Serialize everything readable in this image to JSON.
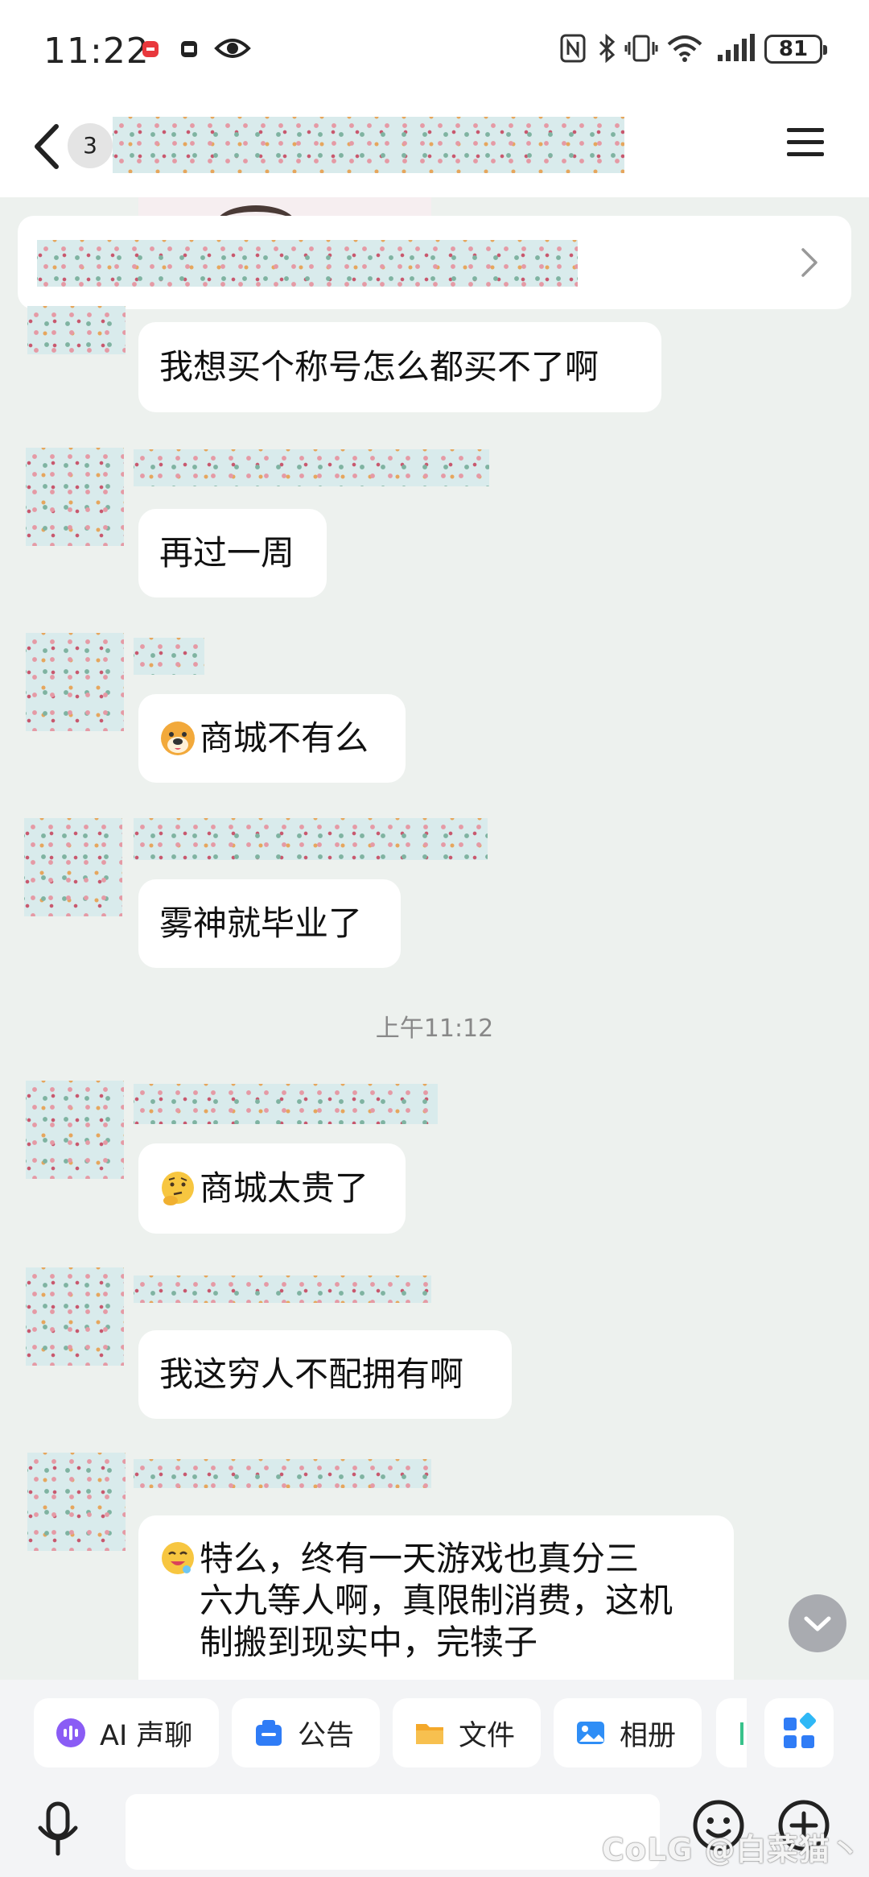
{
  "status_bar": {
    "time": "11:22",
    "battery": "81",
    "icons": [
      "app-notification-icon",
      "app-icon",
      "eye-icon",
      "nfc-icon",
      "bluetooth-icon",
      "vibrate-icon",
      "wifi-icon",
      "signal-icon"
    ]
  },
  "header": {
    "unread_count": "3",
    "back_icon": "chevron-left-icon",
    "menu_icon": "hamburger-menu-icon"
  },
  "messages": [
    {
      "text": "我想买个称号怎么都买不了啊",
      "emoji": ""
    },
    {
      "text": "再过一周",
      "emoji": ""
    },
    {
      "text": "商城不有么",
      "emoji": "dog-face-emoji"
    },
    {
      "text": "雾神就毕业了",
      "emoji": ""
    },
    {
      "text": "商城太贵了",
      "emoji": "thinking-face-emoji"
    },
    {
      "text": "我这穷人不配拥有啊",
      "emoji": ""
    },
    {
      "text": "特么，终有一天游戏也真分三\n六九等人啊，真限制消费，这机\n制搬到现实中，完犊子",
      "emoji": "drooling-face-emoji"
    }
  ],
  "timestamp": "上午11:12",
  "quick_actions": [
    {
      "label": "AI 声聊",
      "icon": "ai-voice-icon",
      "color": "#8a5cf5"
    },
    {
      "label": "公告",
      "icon": "announcement-icon",
      "color": "#2f7cf6"
    },
    {
      "label": "文件",
      "icon": "folder-icon",
      "color": "#f4a82a"
    },
    {
      "label": "相册",
      "icon": "photo-icon",
      "color": "#2f8ef6"
    }
  ],
  "input": {
    "placeholder": ""
  },
  "watermark": "CoLG @白菜猫丶"
}
